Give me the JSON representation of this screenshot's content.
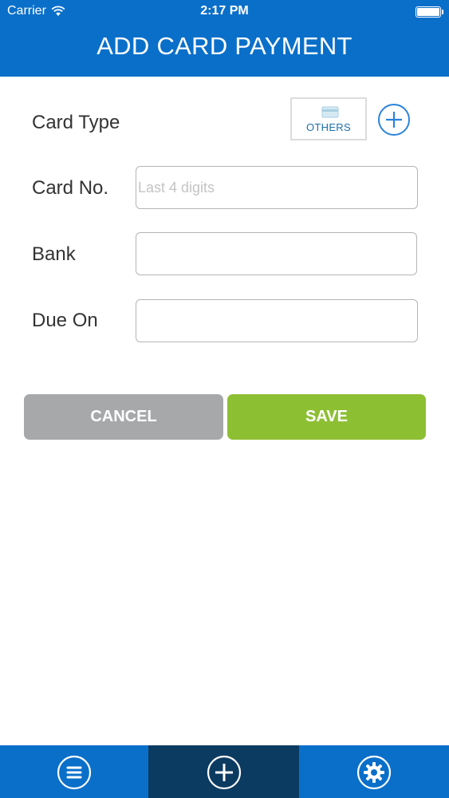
{
  "status_bar": {
    "carrier": "Carrier",
    "time": "2:17 PM"
  },
  "header": {
    "title": "ADD CARD PAYMENT"
  },
  "form": {
    "card_type": {
      "label": "Card Type",
      "selected_option": "OTHERS",
      "icon": "credit-card-icon",
      "add_icon": "plus-circle-icon"
    },
    "card_no": {
      "label": "Card No.",
      "value": "",
      "placeholder": "Last 4 digits"
    },
    "bank": {
      "label": "Bank",
      "value": ""
    },
    "due_on": {
      "label": "Due On",
      "value": ""
    }
  },
  "actions": {
    "cancel_label": "CANCEL",
    "save_label": "SAVE"
  },
  "tab_bar": {
    "active_tab": "add",
    "tabs": [
      {
        "id": "menu",
        "icon": "menu-icon"
      },
      {
        "id": "add",
        "icon": "plus-circle-icon"
      },
      {
        "id": "settings",
        "icon": "gear-icon"
      }
    ]
  },
  "colors": {
    "header": "#0a6fc9",
    "active_tab": "#0c3b61",
    "cancel": "#a7a8aa",
    "save": "#8dbf33",
    "accent": "#2b83dc"
  }
}
